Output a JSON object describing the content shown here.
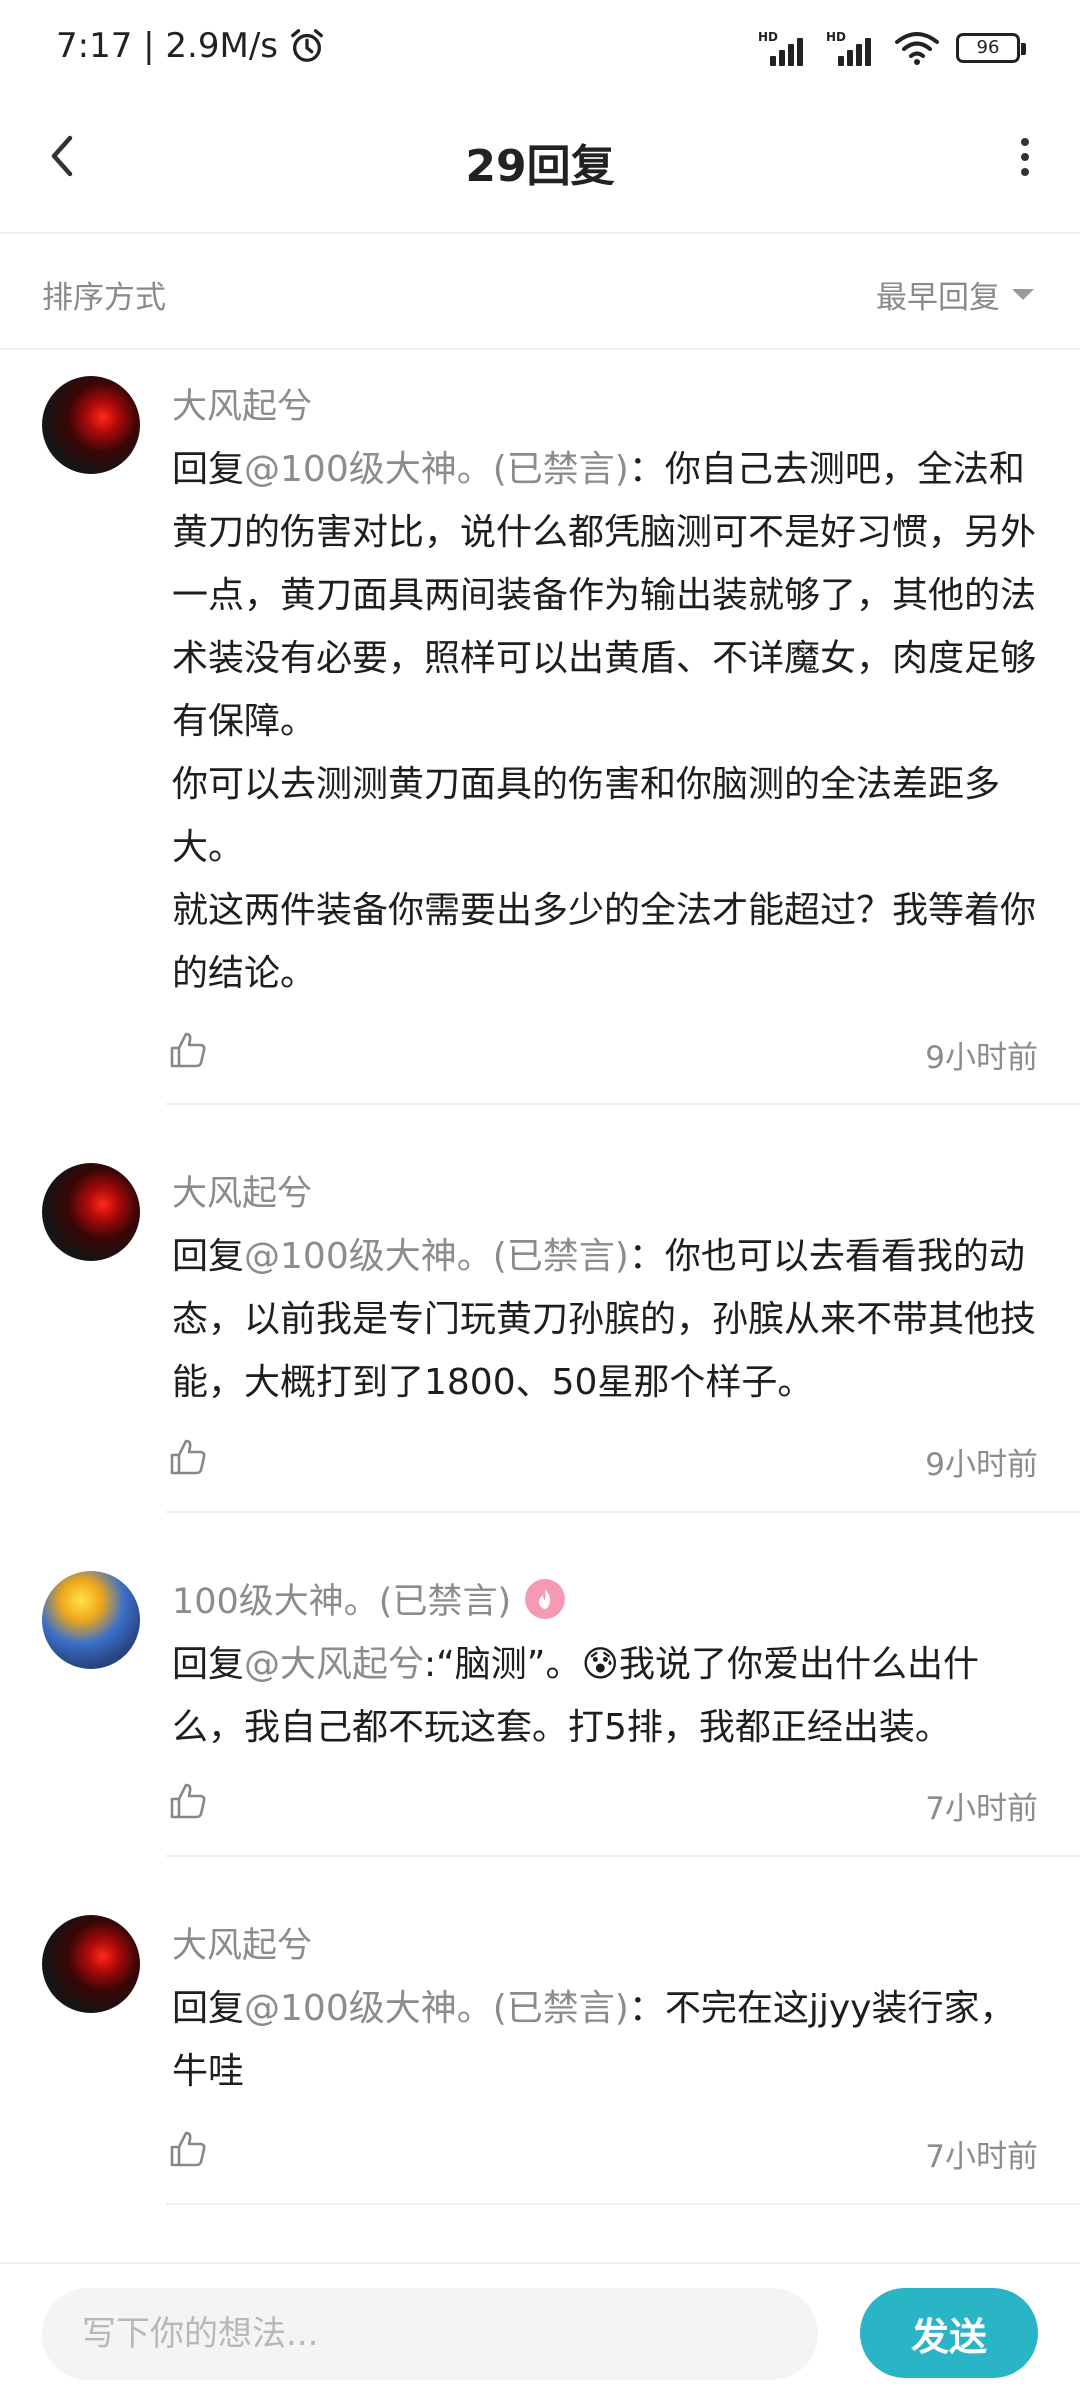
{
  "status_bar": {
    "time_speed": "7:17 | 2.9M/s",
    "battery": "96"
  },
  "header": {
    "title": "29回复"
  },
  "sort": {
    "label": "排序方式",
    "selected": "最早回复"
  },
  "comments": [
    {
      "author": "大风起兮",
      "reply_prefix": "回复",
      "reply_target": "@100级大神。(已禁言)",
      "text": "：你自己去测吧，全法和黄刀的伤害对比，说什么都凭脑测可不是好习惯，另外一点，黄刀面具两间装备作为输出装就够了，其他的法术装没有必要，照样可以出黄盾、不详魔女，肉度足够有保障。\n你可以去测测黄刀面具的伤害和你脑测的全法差距多大。\n就这两件装备你需要出多少的全法才能超过？我等着你的结论。",
      "time": "9小时前"
    },
    {
      "author": "大风起兮",
      "reply_prefix": "回复",
      "reply_target": "@100级大神。(已禁言)",
      "text": "：你也可以去看看我的动态，以前我是专门玩黄刀孙膑的，孙膑从来不带其他技能，大概打到了1800、50星那个样子。",
      "time": "9小时前"
    },
    {
      "author": "100级大神。(已禁言)",
      "reply_prefix": "回复",
      "reply_target": "@大风起兮",
      "text": ":“脑测”。😰我说了你爱出什么出什么，我自己都不玩这套。打5排，我都正经出装。",
      "time": "7小时前"
    },
    {
      "author": "大风起兮",
      "reply_prefix": "回复",
      "reply_target": "@100级大神。(已禁言)",
      "text": "：不完在这jjyy装行家，牛哇",
      "time": "7小时前"
    }
  ],
  "input": {
    "placeholder": "写下你的想法..."
  },
  "send_label": "发送",
  "colors": {
    "accent": "#2ab5c6",
    "secondary_text": "#8c8c8c",
    "badge": "#f59ab5"
  }
}
